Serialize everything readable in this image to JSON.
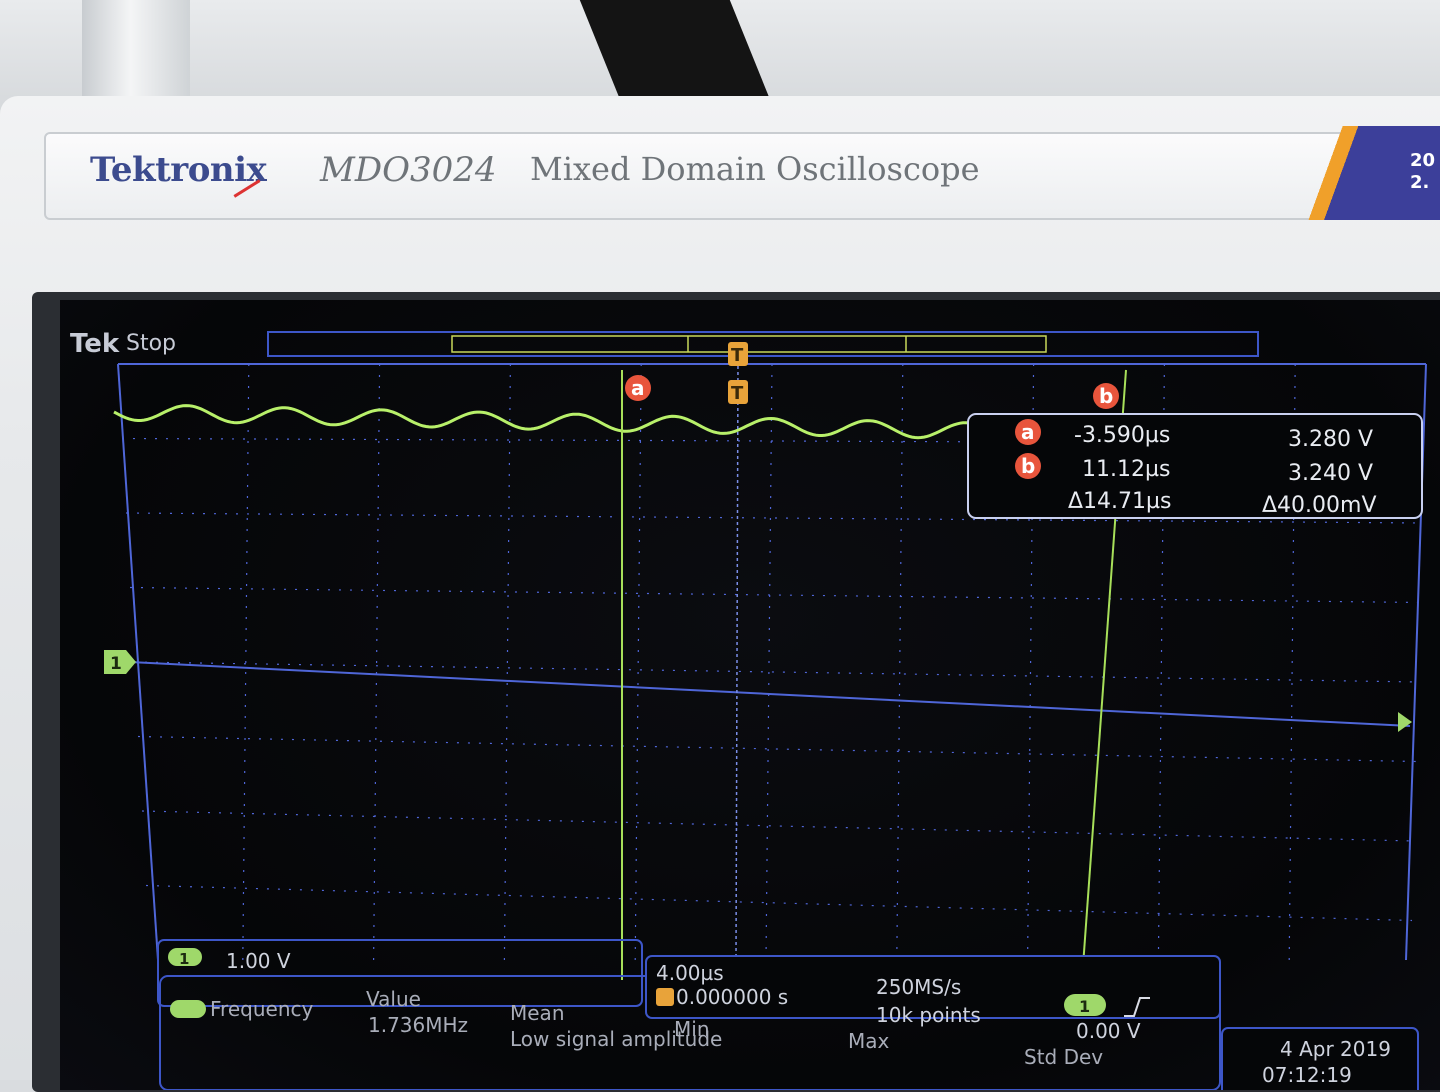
{
  "instrument": {
    "brand": "Tektronix",
    "model": "MDO3024",
    "description": "Mixed Domain Oscilloscope",
    "corner_badge_lines": [
      "20",
      "2."
    ]
  },
  "status": {
    "logo": "Tek",
    "state": "Stop"
  },
  "markers": {
    "trigger": "T",
    "cursor_a": "a",
    "cursor_b": "b",
    "channel": "1"
  },
  "cursor_readout": {
    "a_time": "-3.590µs",
    "a_volt": "3.280 V",
    "b_time": "11.12µs",
    "b_volt": "3.240 V",
    "delta_time": "Δ14.71µs",
    "delta_volt": "Δ40.00mV"
  },
  "channel": {
    "number": "1",
    "scale": "1.00 V"
  },
  "measurement": {
    "label": "Frequency",
    "col_value": "Value",
    "value": "1.736MHz",
    "col_mean": "Mean",
    "note": "Low signal amplitude",
    "col_min": "Min",
    "col_max": "Max",
    "col_stddev": "Std Dev"
  },
  "horizontal": {
    "scale": "4.00µs",
    "position": "0.000000 s",
    "sample_rate": "250MS/s",
    "record_length": "10k points"
  },
  "trigger": {
    "source": "1",
    "slope_icon": "rising-edge-icon",
    "level": "0.00 V"
  },
  "datetime": {
    "date": "4 Apr  2019",
    "time": "07:12:19"
  },
  "colors": {
    "trace": "#b8f06a",
    "grid": "#4f66d8",
    "cursor": "#a8e05a",
    "badge_red": "#e8553c",
    "trigger_orange": "#e8a33a",
    "channel_green": "#9fd86a"
  }
}
